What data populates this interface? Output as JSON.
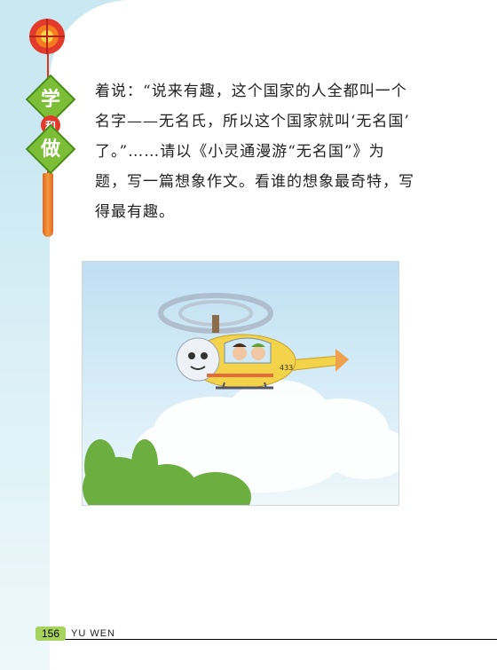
{
  "sidebar": {
    "badge_top": "学",
    "badge_middle": "和",
    "badge_bottom": "做"
  },
  "content": {
    "lines": [
      "着说：“说来有趣，这个国家的人全都叫一个",
      "名字——无名氏，所以这个国家就叫‘无名国’",
      "了。”……请以《小灵通漫游“无名国”》为",
      "题，写一篇想象作文。看谁的想象最奇特，写",
      "得最有趣。"
    ]
  },
  "illustration": {
    "helicopter_number": "433"
  },
  "footer": {
    "page_number": "156",
    "label": "YU WEN"
  },
  "colors": {
    "side_bg": "#c9e8f2",
    "badge_green": "#7cbf37",
    "tassel_red": "#d23a26",
    "helicopter_yellow": "#f3d34a"
  }
}
